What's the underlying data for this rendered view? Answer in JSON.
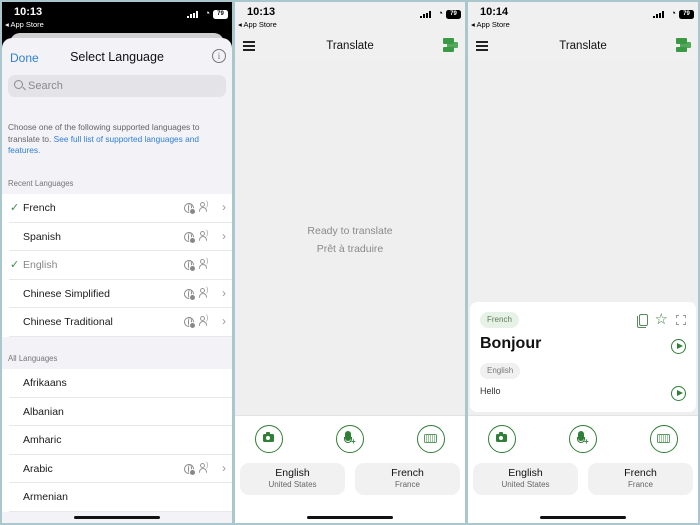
{
  "screens": [
    {
      "status": {
        "time": "10:13",
        "back_app": "App Store",
        "battery": "79"
      },
      "sheet": {
        "done_label": "Done",
        "title": "Select Language",
        "info_icon": "info-icon",
        "search_placeholder": "Search",
        "description": "Choose one of the following supported languages to translate to.",
        "description_link": "See full list of supported languages and features.",
        "recent_header": "Recent Languages",
        "recent": [
          {
            "name": "French",
            "checked": true,
            "dim": false,
            "chevron": true
          },
          {
            "name": "Spanish",
            "checked": false,
            "dim": false,
            "chevron": true
          },
          {
            "name": "English",
            "checked": true,
            "dim": true,
            "chevron": false
          },
          {
            "name": "Chinese Simplified",
            "checked": false,
            "dim": false,
            "chevron": true
          },
          {
            "name": "Chinese Traditional",
            "checked": false,
            "dim": false,
            "chevron": true
          }
        ],
        "all_header": "All Languages",
        "all": [
          {
            "name": "Afrikaans",
            "features": false
          },
          {
            "name": "Albanian",
            "features": false
          },
          {
            "name": "Amharic",
            "features": false
          },
          {
            "name": "Arabic",
            "features": true
          },
          {
            "name": "Armenian",
            "features": false
          }
        ]
      }
    },
    {
      "status": {
        "time": "10:13",
        "back_app": "App Store",
        "battery": "79"
      },
      "nav": {
        "title": "Translate"
      },
      "ready_line1": "Ready to translate",
      "ready_line2": "Prêt à traduire",
      "source": {
        "language": "English",
        "region": "United States"
      },
      "target": {
        "language": "French",
        "region": "France"
      }
    },
    {
      "status": {
        "time": "10:14",
        "back_app": "App Store",
        "battery": "79"
      },
      "nav": {
        "title": "Translate"
      },
      "card": {
        "target_chip": "French",
        "translation": "Bonjour",
        "source_chip": "English",
        "original": "Hello"
      },
      "source": {
        "language": "English",
        "region": "United States"
      },
      "target": {
        "language": "French",
        "region": "France"
      }
    }
  ],
  "colors": {
    "accent_green": "#2f7f36",
    "link_blue": "#2f7fd6",
    "check_green": "#3f8a46"
  }
}
